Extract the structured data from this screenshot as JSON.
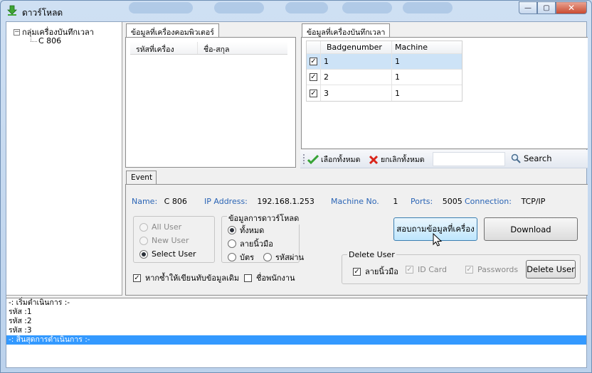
{
  "window": {
    "title": "ดาวร์โหลด",
    "min": "—",
    "max": "▢",
    "close": "✕"
  },
  "tree": {
    "root": "กลุ่มเครื่องบันทึกเวลา",
    "expander": "−",
    "children": [
      "C 806"
    ]
  },
  "computer_panel": {
    "tab": "ข้อมูลที่เครื่องคอมพิวเตอร์",
    "columns": [
      "รหัสที่เครื่อง",
      "ชื่อ-สกุล"
    ]
  },
  "device_panel": {
    "tab": "ข้อมูลที่เครื่องบันทึกเวลา",
    "columns": [
      "Badgenumber",
      "Machine"
    ],
    "rows": [
      {
        "checked": true,
        "badge": "1",
        "machine": "1"
      },
      {
        "checked": true,
        "badge": "2",
        "machine": "1"
      },
      {
        "checked": true,
        "badge": "3",
        "machine": "1"
      }
    ]
  },
  "toolbar": {
    "select_all": "เลือกทั้งหมด",
    "deselect_all": "ยกเลิกทั้งหมด",
    "search": "Search"
  },
  "event": {
    "tab": "Event",
    "name_label": "Name:",
    "name_value": "C 806",
    "ip_label": "IP Address:",
    "ip_value": "192.168.1.253",
    "machine_label": "Machine No.",
    "machine_value": "1",
    "ports_label": "Ports:",
    "ports_value": "5005",
    "conn_label": "Connection:",
    "conn_value": "TCP/IP",
    "user_options": {
      "all": "All User",
      "new": "New User",
      "select": "Select User"
    },
    "download_group": {
      "title": "ข้อมูลการดาวร์โหลด",
      "all": "ทั้งหมด",
      "fingerprint": "ลายนิ้วมือ",
      "card": "บัตร",
      "password": "รหัสผ่าน"
    },
    "overwrite": "หากซ้ำให้เขียนทับข้อมูลเดิม",
    "employee_name": "ชื่อพนักงาน",
    "query_button": "สอบถามข้อมูลที่เครื่อง",
    "download_button": "Download",
    "delete_group": {
      "title": "Delete User",
      "fingerprint": "ลายนิ้วมือ",
      "id_card": "ID Card",
      "passwords": "Passwords",
      "button": "Delete User"
    }
  },
  "log": [
    "-: เริ่มดำเนินการ :-",
    "รหัส :1",
    "รหัส :2",
    "รหัส :3",
    "-: สิ้นสุดการดำเนินการ :-"
  ],
  "check_mark": "✓"
}
